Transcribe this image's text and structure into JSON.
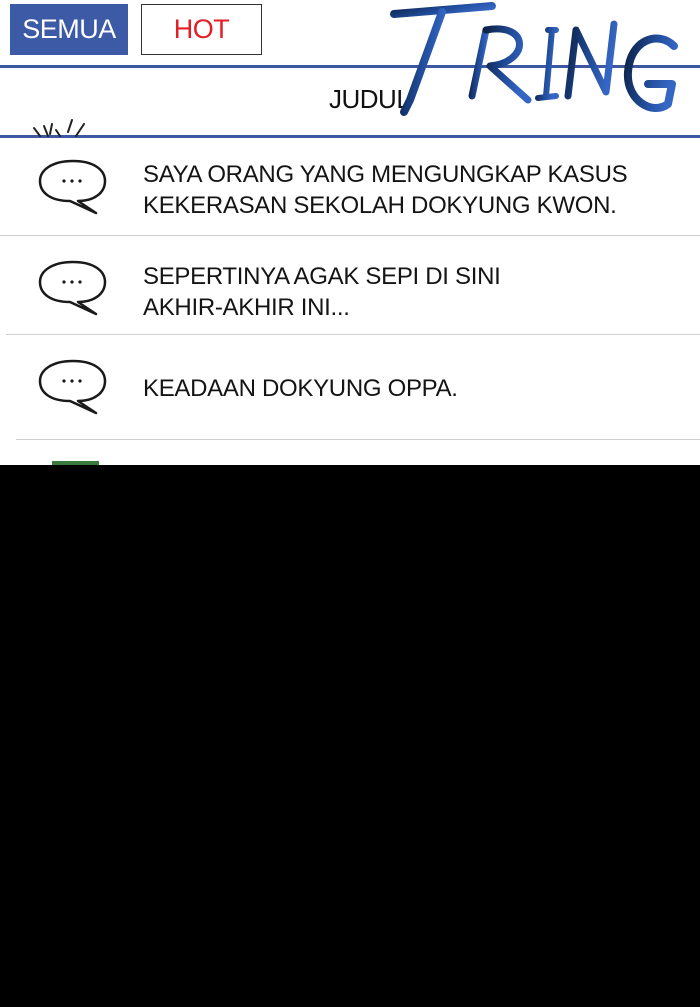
{
  "tabs": {
    "all_label": "SEMUA",
    "hot_label": "HOT"
  },
  "header": {
    "column_title": "JUDUL",
    "sound_effect": "TRING"
  },
  "posts": [
    {
      "line1": "SAYA ORANG YANG MENGUNGKAP KASUS",
      "line2": "KEKERASAN SEKOLAH DOKYUNG KWON."
    },
    {
      "line1": "SEPERTINYA AGAK SEPI DI SINI",
      "line2": "AKHIR-AKHIR INI..."
    },
    {
      "line1": "KEADAAN DOKYUNG OPPA.",
      "line2": ""
    }
  ],
  "icons": {
    "comment": "speech-bubble-icon",
    "impact": "impact-lines-icon"
  },
  "colors": {
    "accent_blue": "#3c5aa6",
    "hot_red": "#e41e26",
    "sfx_navy": "#102a55",
    "sfx_blue": "#2f5fb8"
  }
}
